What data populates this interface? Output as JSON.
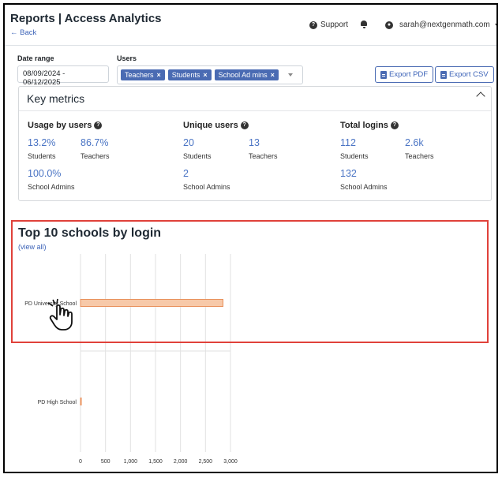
{
  "header": {
    "title": "Reports | Access Analytics",
    "back": "← Back",
    "support": "Support",
    "user_email": "sarah@nextgenmath.com"
  },
  "filters": {
    "date_label": "Date range",
    "date_value": "08/09/2024 - 06/12/2025",
    "users_label": "Users",
    "tags": [
      "Teachers",
      "Students",
      "School Ad mins"
    ],
    "export_pdf": "Export PDF",
    "export_csv": "Export CSV"
  },
  "key_metrics": {
    "title": "Key metrics",
    "groups": [
      {
        "title": "Usage by users",
        "items": [
          {
            "value": "13.2%",
            "label": "Students"
          },
          {
            "value": "86.7%",
            "label": "Teachers"
          },
          {
            "value": "100.0%",
            "label": "School Admins"
          }
        ]
      },
      {
        "title": "Unique users",
        "items": [
          {
            "value": "20",
            "label": "Students"
          },
          {
            "value": "13",
            "label": "Teachers"
          },
          {
            "value": "2",
            "label": "School Admins"
          }
        ]
      },
      {
        "title": "Total logins",
        "items": [
          {
            "value": "112",
            "label": "Students"
          },
          {
            "value": "2.6k",
            "label": "Teachers"
          },
          {
            "value": "132",
            "label": "School Admins"
          }
        ]
      }
    ]
  },
  "top_schools": {
    "title": "Top 10 schools by login",
    "view_all": "(view all)"
  },
  "chart_data": {
    "type": "bar",
    "orientation": "horizontal",
    "categories": [
      "PD University School",
      "PD High School"
    ],
    "values": [
      2850,
      5
    ],
    "xlim": [
      0,
      3000
    ],
    "xticks": [
      "0",
      "500",
      "1,000",
      "1,500",
      "2,000",
      "2,500",
      "3,000"
    ],
    "grid": true,
    "bar_color": "#f7c9a9",
    "bar_border": "#e8905b"
  },
  "colors": {
    "accent": "#3d64b8",
    "highlight": "#e0413a"
  }
}
